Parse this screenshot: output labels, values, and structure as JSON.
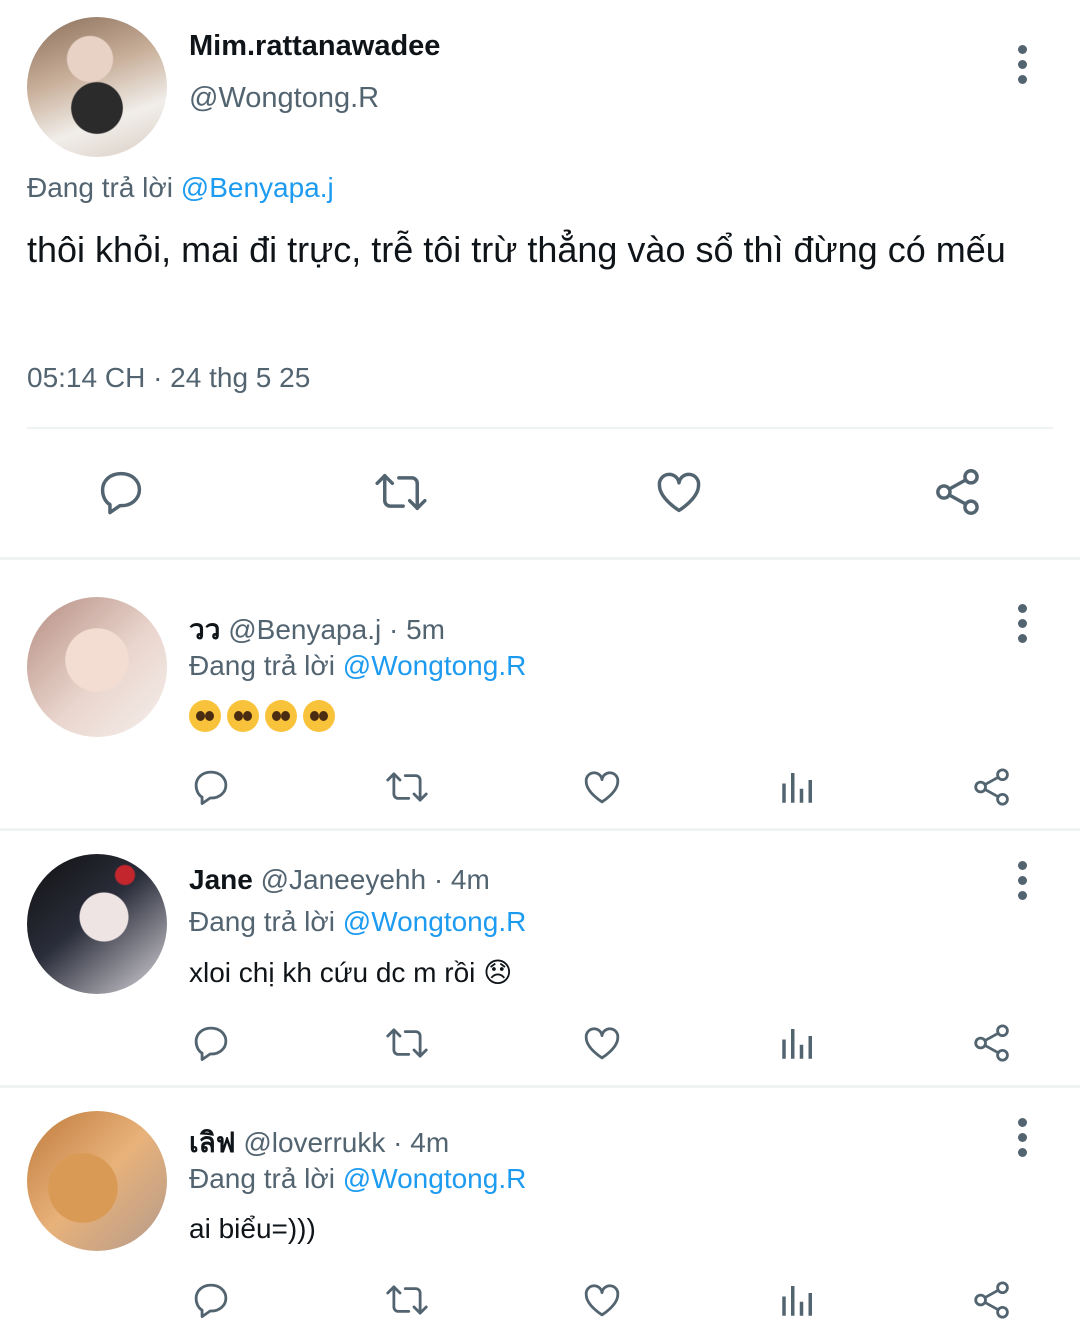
{
  "tweet": {
    "display_name": "Mim.rattanawadee",
    "handle": "@Wongtong.R",
    "replying_prefix": "Đang trả lời",
    "replying_to": "@Benyapa.j",
    "text": "thôi khỏi, mai đi trực, trễ tôi trừ thẳng vào sổ thì đừng có mếu",
    "timestamp": "05:14 CH · 24 thg 5 25"
  },
  "replies": [
    {
      "display_name": "วว",
      "handle": "@Benyapa.j",
      "time": "· 5m",
      "replying_prefix": "Đang trả lời",
      "replying_to": "@Wongtong.R",
      "text": "🥺🥺🥺🥺"
    },
    {
      "display_name": "Jane",
      "handle": "@Janeeyehh",
      "time": "· 4m",
      "replying_prefix": "Đang trả lời",
      "replying_to": "@Wongtong.R",
      "text": "xloi chị kh cứu dc m rồi 😞"
    },
    {
      "display_name": "เลิฟ",
      "handle": "@loverrukk",
      "time": "· 4m",
      "replying_prefix": "Đang trả lời",
      "replying_to": "@Wongtong.R",
      "text": "ai biểu=)))"
    }
  ],
  "icons": [
    "reply-icon",
    "retweet-icon",
    "like-icon",
    "share-icon",
    "views-icon",
    "more-icon"
  ],
  "colors": {
    "link": "#1d9bf0",
    "secondary_text": "#536471",
    "divider": "#eff3f4"
  }
}
